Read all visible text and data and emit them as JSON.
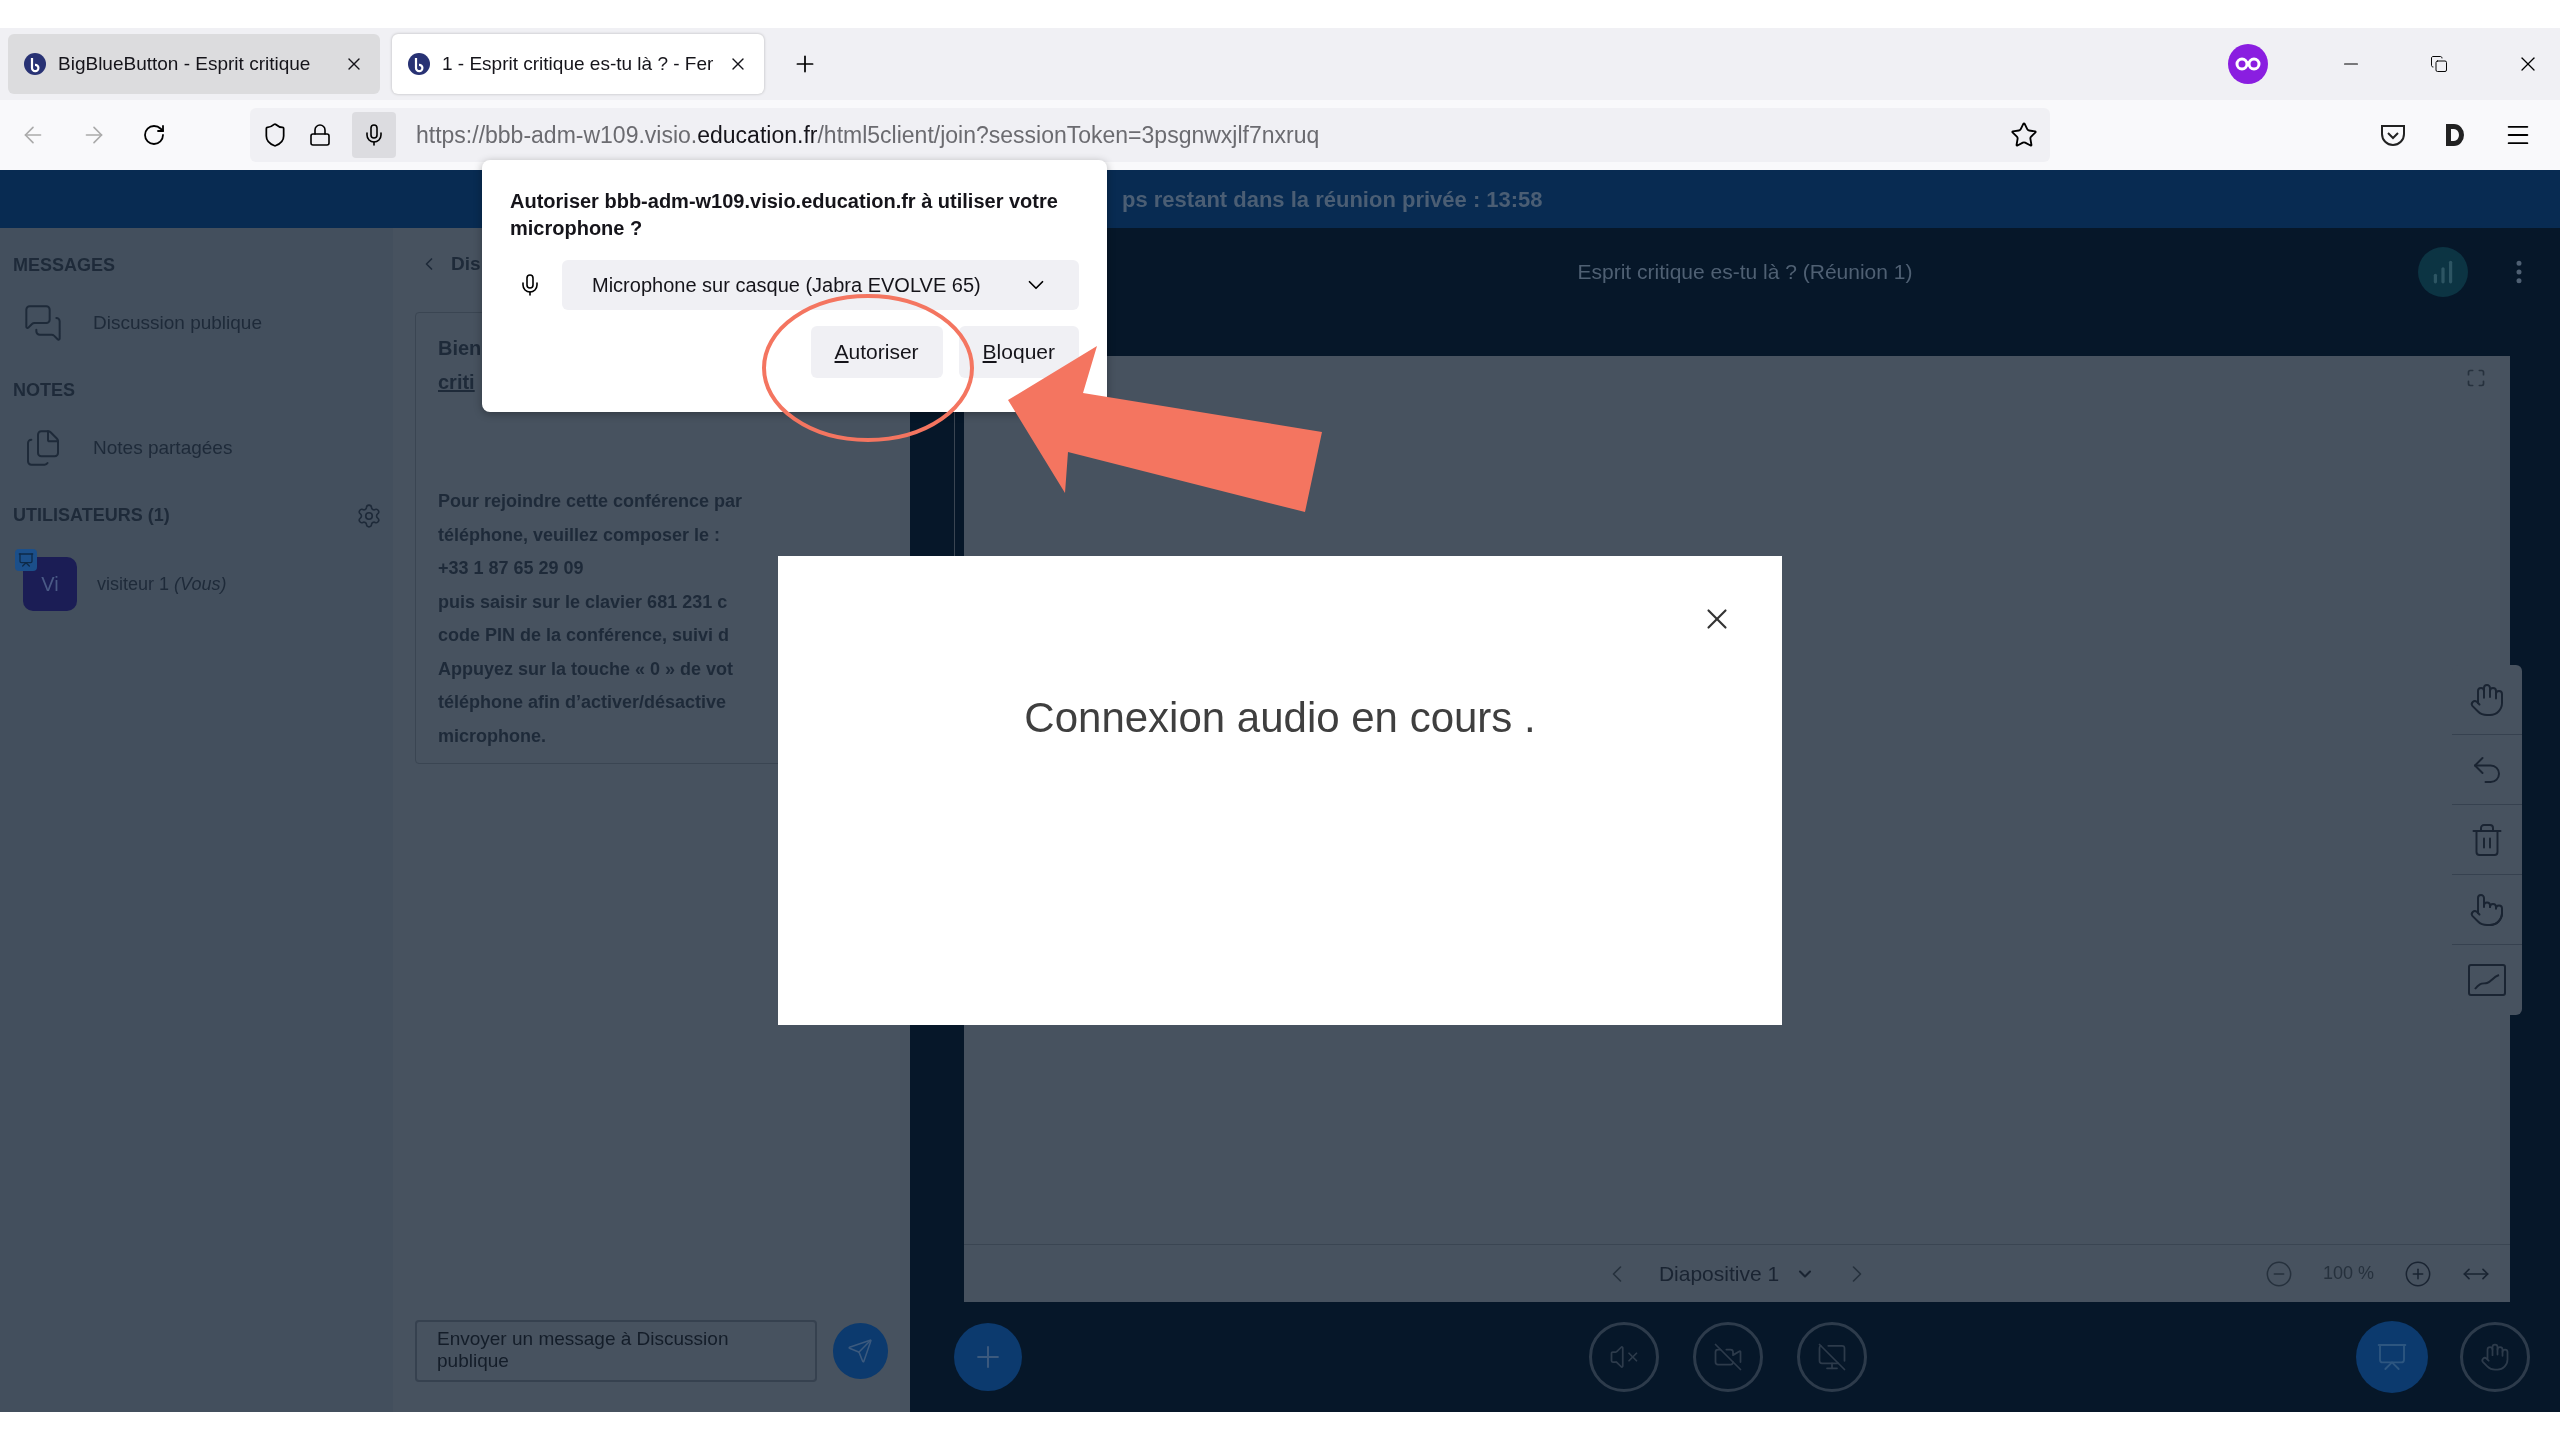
{
  "browser": {
    "tabs": [
      {
        "title": "BigBlueButton - Esprit critique",
        "selected": false
      },
      {
        "title": "1 - Esprit critique es-tu là ? - Fer",
        "selected": true
      }
    ],
    "url": {
      "before": "https://bbb-adm-w109.visio.",
      "domain": "education.fr",
      "after": "/html5client/join?sessionToken=3psgnwxjlf7nxruq"
    }
  },
  "permission_prompt": {
    "message": "Autoriser bbb-adm-w109.visio.education.fr à utiliser votre microphone ?",
    "device": "Microphone sur casque (Jabra EVOLVE 65)",
    "buttons": [
      "Autoriser",
      "Bloquer"
    ]
  },
  "banner": {
    "text": "ps restant dans la réunion privée : 13:58"
  },
  "sidebar": {
    "sections": [
      {
        "heading": "MESSAGES",
        "items": [
          {
            "label": "Discussion publique",
            "kind": "chat"
          }
        ]
      },
      {
        "heading": "NOTES",
        "items": [
          {
            "label": "Notes partagées",
            "kind": "notes"
          }
        ]
      }
    ],
    "users": {
      "heading": "UTILISATEURS (1)",
      "list": [
        {
          "initials": "Vi",
          "name": "visiteur 1",
          "tag": "(Vous)",
          "presenter": true
        }
      ]
    }
  },
  "chat": {
    "header": "Dis",
    "welcome": [
      "Bien",
      "criti"
    ],
    "message_lines": [
      "Pour rejoindre cette conférence par",
      "téléphone, veuillez composer le :",
      "+33 1 87 65 29 09",
      "puis saisir sur le clavier 681 231 c",
      "code PIN de la conférence, suivi d",
      "Appuyez sur la touche « 0 » de vot",
      "téléphone afin d’activer/désactive",
      "microphone."
    ],
    "input": {
      "placeholder": "Envoyer un message à Discussion publique"
    }
  },
  "presentation": {
    "title": "Esprit critique es-tu là ? (Réunion 1)",
    "slide": "Diapositive 1",
    "zoom": "100 %"
  },
  "modal": {
    "text": "Connexion audio en cours ."
  }
}
